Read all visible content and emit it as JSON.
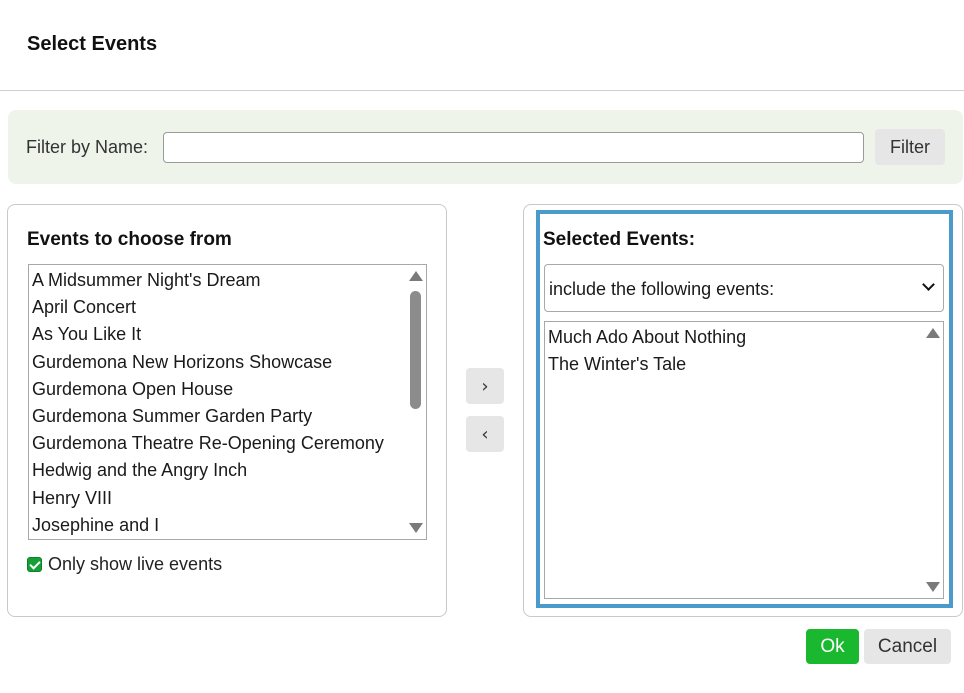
{
  "dialog": {
    "title": "Select Events"
  },
  "filter": {
    "label": "Filter by Name:",
    "value": "",
    "placeholder": "",
    "button_label": "Filter"
  },
  "available": {
    "heading": "Events to choose from",
    "items": [
      "A Midsummer Night's Dream",
      "April Concert",
      "As You Like It",
      "Gurdemona New Horizons Showcase",
      "Gurdemona Open House",
      "Gurdemona Summer Garden Party",
      "Gurdemona Theatre Re-Opening Ceremony",
      "Hedwig and the Angry Inch",
      "Henry VIII",
      "Josephine and I"
    ],
    "checkbox_label": "Only show live events",
    "checkbox_checked": true
  },
  "move": {
    "right_label": "›",
    "left_label": "‹"
  },
  "selected": {
    "heading": "Selected Events:",
    "mode_value": "include the following events:",
    "items": [
      "Much Ado About Nothing",
      "The Winter's Tale"
    ]
  },
  "actions": {
    "ok_label": "Ok",
    "cancel_label": "Cancel"
  },
  "colors": {
    "accent_focus": "#4a9bcb",
    "ok_green": "#19b82e",
    "filter_bg": "#eef4ea",
    "checkbox_green": "#14a035"
  },
  "icons": {
    "select": "chevron-down-icon",
    "scroll_up": "scroll-up-arrow-icon",
    "scroll_down": "scroll-down-arrow-icon"
  }
}
